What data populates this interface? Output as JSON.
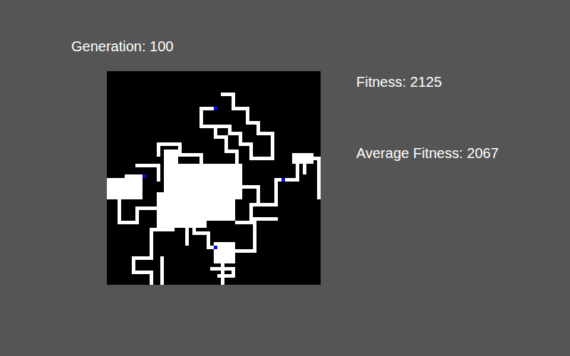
{
  "generation": {
    "label": "Generation: 100"
  },
  "stats": [
    {
      "label": "Fitness: 2125"
    },
    {
      "label": "Average Fitness: 2067"
    }
  ],
  "canvas": {
    "grid": 60,
    "paths": [
      [
        [
          32,
          6
        ],
        [
          35,
          6
        ],
        [
          35,
          10
        ],
        [
          39,
          10
        ],
        [
          39,
          14
        ],
        [
          42,
          14
        ],
        [
          42,
          17
        ],
        [
          46,
          17
        ],
        [
          46,
          24
        ],
        [
          40,
          24
        ],
        [
          40,
          20
        ],
        [
          37,
          20
        ],
        [
          37,
          17
        ],
        [
          34,
          17
        ],
        [
          34,
          15
        ],
        [
          31,
          15
        ]
      ],
      [
        [
          30,
          10
        ],
        [
          26,
          10
        ],
        [
          26,
          15
        ],
        [
          30,
          15
        ],
        [
          30,
          18
        ],
        [
          33,
          18
        ],
        [
          33,
          22
        ],
        [
          36,
          22
        ],
        [
          36,
          27
        ]
      ],
      [
        [
          14,
          23
        ],
        [
          14,
          20
        ],
        [
          20,
          20
        ],
        [
          20,
          23
        ],
        [
          26,
          23
        ],
        [
          26,
          28
        ]
      ],
      [
        [
          10,
          29
        ],
        [
          5,
          29
        ],
        [
          5,
          31
        ],
        [
          1,
          31
        ],
        [
          1,
          34
        ],
        [
          0,
          34
        ]
      ],
      [
        [
          8,
          26
        ],
        [
          14,
          26
        ],
        [
          14,
          30
        ]
      ],
      [
        [
          3,
          36
        ],
        [
          3,
          42
        ],
        [
          8,
          42
        ],
        [
          8,
          38
        ],
        [
          14,
          38
        ]
      ],
      [
        [
          49,
          30
        ],
        [
          53,
          30
        ],
        [
          53,
          24
        ],
        [
          59,
          24
        ],
        [
          59,
          35
        ]
      ],
      [
        [
          49,
          30
        ],
        [
          47,
          30
        ],
        [
          47,
          37
        ],
        [
          40,
          37
        ],
        [
          40,
          41
        ],
        [
          47,
          41
        ]
      ],
      [
        [
          38,
          32
        ],
        [
          42,
          32
        ],
        [
          42,
          36
        ]
      ],
      [
        [
          30,
          49
        ],
        [
          30,
          53
        ],
        [
          32,
          53
        ],
        [
          32,
          59
        ]
      ],
      [
        [
          30,
          49
        ],
        [
          28,
          49
        ],
        [
          28,
          45
        ],
        [
          24,
          45
        ],
        [
          24,
          40
        ]
      ],
      [
        [
          36,
          42
        ],
        [
          41,
          42
        ],
        [
          41,
          50
        ],
        [
          36,
          50
        ]
      ],
      [
        [
          18,
          44
        ],
        [
          12,
          44
        ],
        [
          12,
          52
        ],
        [
          7,
          52
        ],
        [
          7,
          56
        ],
        [
          12,
          56
        ],
        [
          12,
          59
        ]
      ],
      [
        [
          15,
          52
        ],
        [
          15,
          59
        ]
      ],
      [
        [
          22,
          44
        ],
        [
          22,
          48
        ]
      ],
      [
        [
          55,
          25
        ],
        [
          55,
          28
        ]
      ],
      [
        [
          29,
          55
        ],
        [
          35,
          55
        ],
        [
          35,
          57
        ],
        [
          31,
          57
        ]
      ]
    ],
    "blocks": [
      [
        16,
        26,
        10,
        8
      ],
      [
        26,
        26,
        12,
        10
      ],
      [
        14,
        34,
        14,
        10
      ],
      [
        0,
        30,
        10,
        6
      ],
      [
        28,
        36,
        8,
        6
      ],
      [
        30,
        48,
        6,
        6
      ],
      [
        16,
        22,
        4,
        4
      ],
      [
        52,
        23,
        6,
        3
      ]
    ],
    "agents": [
      {
        "x": 30,
        "y": 10
      },
      {
        "x": 10,
        "y": 29
      },
      {
        "x": 49,
        "y": 30
      },
      {
        "x": 30,
        "y": 49
      }
    ]
  }
}
